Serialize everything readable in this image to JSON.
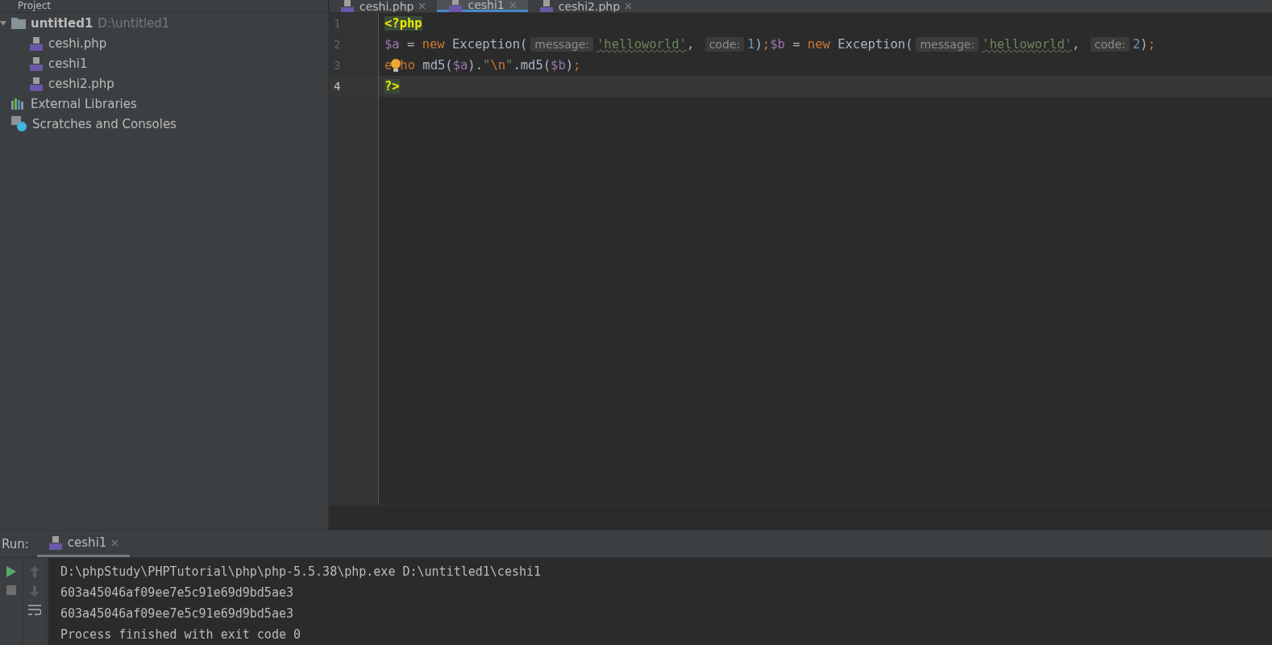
{
  "project_bar": {
    "title": "Project"
  },
  "editor_tabs": [
    {
      "label": "ceshi.php",
      "selected": false
    },
    {
      "label": "ceshi1",
      "selected": true
    },
    {
      "label": "ceshi2.php",
      "selected": false
    }
  ],
  "project_tree": [
    {
      "label": "untitled1",
      "path": "D:\\untitled1",
      "kind": "folder",
      "expanded": true,
      "children": [
        {
          "label": "ceshi.php",
          "kind": "php"
        },
        {
          "label": "ceshi1",
          "kind": "php"
        },
        {
          "label": "ceshi2.php",
          "kind": "php"
        }
      ]
    },
    {
      "label": "External Libraries",
      "kind": "libraries"
    },
    {
      "label": "Scratches and Consoles",
      "kind": "scratches"
    }
  ],
  "editor": {
    "lines": [
      {
        "number": "1",
        "current": false,
        "tokens": [
          {
            "kind": "tag",
            "text": "<?php"
          }
        ]
      },
      {
        "number": "2",
        "current": false,
        "tokens": [
          {
            "kind": "var",
            "text": "$a"
          },
          {
            "kind": "plain",
            "text": " = "
          },
          {
            "kind": "keyword",
            "text": "new"
          },
          {
            "kind": "plain",
            "text": " Exception("
          },
          {
            "kind": "hint",
            "text": "message:"
          },
          {
            "kind": "string",
            "text": "'helloworld'"
          },
          {
            "kind": "plain",
            "text": ", "
          },
          {
            "kind": "hint",
            "text": "code:"
          },
          {
            "kind": "number",
            "text": "1"
          },
          {
            "kind": "plain",
            "text": ")"
          },
          {
            "kind": "keyword",
            "text": ";"
          },
          {
            "kind": "var",
            "text": "$b"
          },
          {
            "kind": "plain",
            "text": " = "
          },
          {
            "kind": "keyword",
            "text": "new"
          },
          {
            "kind": "plain",
            "text": " Exception("
          },
          {
            "kind": "hint",
            "text": "message:"
          },
          {
            "kind": "string",
            "text": "'helloworld'"
          },
          {
            "kind": "plain",
            "text": ", "
          },
          {
            "kind": "hint",
            "text": "code:"
          },
          {
            "kind": "number",
            "text": "2"
          },
          {
            "kind": "plain",
            "text": ")"
          },
          {
            "kind": "keyword",
            "text": ";"
          }
        ]
      },
      {
        "number": "3",
        "current": false,
        "tokens": [
          {
            "kind": "keyword",
            "text": "e"
          },
          {
            "kind": "bulb"
          },
          {
            "kind": "keyword",
            "text": "ho"
          },
          {
            "kind": "plain",
            "text": " md5("
          },
          {
            "kind": "var",
            "text": "$a"
          },
          {
            "kind": "plain",
            "text": ")."
          },
          {
            "kind": "string2",
            "text": "\""
          },
          {
            "kind": "escape",
            "text": "\\n"
          },
          {
            "kind": "string2",
            "text": "\""
          },
          {
            "kind": "plain",
            "text": ".md5("
          },
          {
            "kind": "var",
            "text": "$b"
          },
          {
            "kind": "plain",
            "text": ")"
          },
          {
            "kind": "keyword",
            "text": ";"
          }
        ]
      },
      {
        "number": "4",
        "current": true,
        "tokens": [
          {
            "kind": "tag",
            "text": "?>"
          }
        ]
      }
    ]
  },
  "run_panel": {
    "label": "Run:",
    "tab": {
      "label": "ceshi1",
      "selected": true
    },
    "output": [
      "D:\\phpStudy\\PHPTutorial\\php\\php-5.5.38\\php.exe D:\\untitled1\\ceshi1",
      "603a45046af09ee7e5c91e69d9bd5ae3",
      "603a45046af09ee7e5c91e69d9bd5ae3",
      "Process finished with exit code 0"
    ]
  }
}
